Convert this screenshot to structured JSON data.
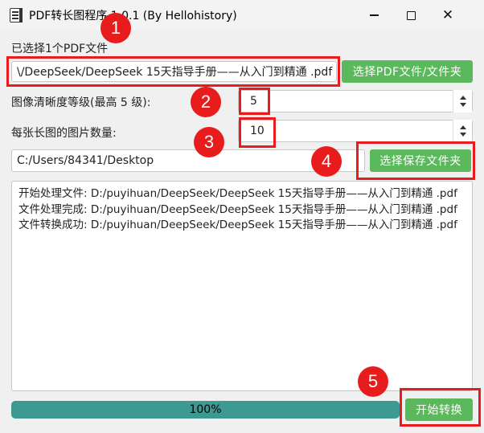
{
  "window": {
    "title": "PDF转长图程序 1.0.1 (By Hellohistory)",
    "icon": "document-icon"
  },
  "pdf_section": {
    "label": "已选择1个PDF文件",
    "path_value": "\\/DeepSeek/DeepSeek 15天指导手册——从入门到精通 .pdf",
    "select_button": "选择PDF文件/文件夹"
  },
  "clarity": {
    "label": "图像清晰度等级(最高 5 级):",
    "value": "5"
  },
  "images_per_long": {
    "label": "每张长图的图片数量:",
    "value": "10"
  },
  "output": {
    "path_value": "C:/Users/84341/Desktop",
    "select_button": "选择保存文件夹"
  },
  "log": {
    "lines": [
      "开始处理文件: D:/puyihuan/DeepSeek/DeepSeek 15天指导手册——从入门到精通 .pdf",
      "文件处理完成: D:/puyihuan/DeepSeek/DeepSeek 15天指导手册——从入门到精通 .pdf",
      "文件转换成功: D:/puyihuan/DeepSeek/DeepSeek 15天指导手册——从入门到精通 .pdf"
    ]
  },
  "progress": {
    "value": 100,
    "label": "100%"
  },
  "start_button": "开始转换",
  "annotations": {
    "badges": [
      "1",
      "2",
      "3",
      "4",
      "5"
    ],
    "color": "#e81c1c"
  },
  "colors": {
    "accent_green": "#5cb85c",
    "progress_teal": "#3d9a93"
  }
}
